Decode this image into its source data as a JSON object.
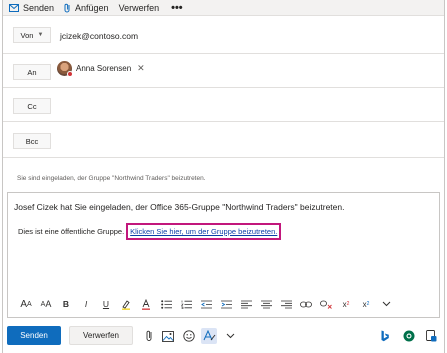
{
  "toolbar": {
    "send_label": "Senden",
    "attach_label": "Anfügen",
    "discard_label": "Verwerfen",
    "more_label": "•••"
  },
  "header": {
    "from_label": "Von",
    "from_email": "jcizek@contoso.com",
    "to_label": "An",
    "recipient_name": "Anna Sorensen",
    "cc_label": "Cc",
    "bcc_label": "Bcc"
  },
  "info_line": "Sie sind eingeladen, der Gruppe \"Northwind Traders\" beizutreten.",
  "body": {
    "paragraph1": "Josef Cizek hat Sie eingeladen, der Office 365-Gruppe \"Northwind Traders\" beizutreten.",
    "paragraph2_prefix": "Dies ist eine öffentliche Gruppe.",
    "link_text": "Klicken Sie hier, um der Gruppe beizutreten."
  },
  "format_bar": {
    "items": [
      "font-size-icon",
      "font-size-small-icon",
      "bold-icon",
      "italic-icon",
      "underline-icon",
      "highlight-icon",
      "font-color-icon",
      "bullets-icon",
      "numbering-icon",
      "decrease-indent-icon",
      "increase-indent-icon",
      "align-left-icon",
      "align-center-icon",
      "align-right-icon",
      "link-icon",
      "remove-link-icon",
      "superscript-icon",
      "subscript-icon",
      "more-chevron-icon"
    ]
  },
  "bottom_bar": {
    "send_label": "Senden",
    "discard_label": "Verwerfen"
  },
  "colors": {
    "accent": "#0f6cbd",
    "link": "#0b3fa8",
    "highlight_box": "#c2177c",
    "presence_busy": "#d13438"
  }
}
